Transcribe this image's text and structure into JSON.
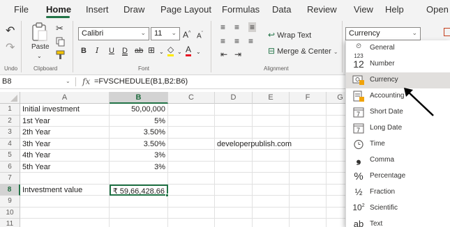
{
  "menu": {
    "tabs": [
      "File",
      "Home",
      "Insert",
      "Draw",
      "Page Layout",
      "Formulas",
      "Data",
      "Review",
      "View",
      "Help",
      "Open i"
    ]
  },
  "ribbon": {
    "undo_label": "Undo",
    "clipboard_label": "Clipboard",
    "paste_label": "Paste",
    "font_label": "Font",
    "alignment_label": "Alignment",
    "font_name": "Calibri",
    "font_size": "11",
    "wrap_text": "Wrap Text",
    "merge_center": "Merge & Center",
    "number_format": "Currency"
  },
  "formula_bar": {
    "name_box": "B8",
    "fx": "fx",
    "formula": "=FVSCHEDULE(B1,B2:B6)"
  },
  "grid": {
    "columns": [
      "A",
      "B",
      "C",
      "D",
      "E",
      "F",
      "G"
    ],
    "rows": [
      "1",
      "2",
      "3",
      "4",
      "5",
      "6",
      "7",
      "8",
      "9",
      "10",
      "11"
    ],
    "cells": {
      "a1": "Initial investment",
      "b1": "50,00,000",
      "a2": "1st Year",
      "b2": "5%",
      "a3": "2th Year",
      "b3": "3.50%",
      "a4": "3th Year",
      "b4": "3.50%",
      "a5": "4th Year",
      "b5": "3%",
      "a6": "5th Year",
      "b6": "3%",
      "a8": "Intvestment value",
      "b8": "₹ 59,66,428.66",
      "d4": "developerpublish.com"
    }
  },
  "number_format_menu": {
    "items": [
      {
        "icon": "123",
        "label": "General"
      },
      {
        "icon": "12",
        "label": "Number"
      },
      {
        "icon": "currency",
        "label": "Currency"
      },
      {
        "icon": "accounting",
        "label": "Accounting"
      },
      {
        "icon": "7",
        "label": "Short Date"
      },
      {
        "icon": "7",
        "label": "Long Date"
      },
      {
        "icon": "clock",
        "label": "Time"
      },
      {
        "icon": "9",
        "label": "Comma"
      },
      {
        "icon": "%",
        "label": "Percentage"
      },
      {
        "icon": "1/2",
        "label": "Fraction"
      },
      {
        "icon": "10²",
        "label": "Scientific"
      },
      {
        "icon": "ab",
        "label": "Text"
      }
    ]
  },
  "colors": {
    "accent": "#217346",
    "ribbon_bg": "#f3f3f3"
  }
}
